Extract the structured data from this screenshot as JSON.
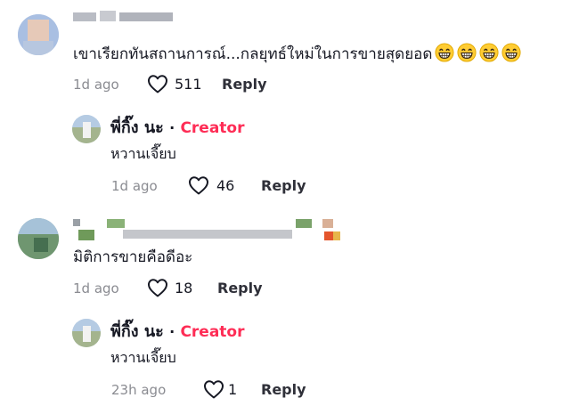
{
  "comments": [
    {
      "text": "เขาเรียกทันสถานการณ์...กลยุทธ์ใหม่ในการขายสุดยอด",
      "emoji": "grinning-face-icon",
      "emoji_count": 4,
      "time": "1d ago",
      "likes": "511",
      "reply_label": "Reply",
      "reply": {
        "author": "พี่กิ๊ง นะ",
        "separator": "·",
        "badge": "Creator",
        "text": "หวานเจี๊ยบ",
        "time": "1d ago",
        "likes": "46",
        "reply_label": "Reply"
      }
    },
    {
      "text": "มิติการขายคือดีอะ",
      "time": "1d ago",
      "likes": "18",
      "reply_label": "Reply",
      "reply": {
        "author": "พี่กิ๊ง นะ",
        "separator": "·",
        "badge": "Creator",
        "text": "หวานเจี๊ยบ",
        "time": "23h ago",
        "likes": "1",
        "reply_label": "Reply"
      }
    }
  ],
  "colors": {
    "creator_badge": "#fe2c55",
    "meta_text": "#8a8b91",
    "primary_text": "#161823"
  }
}
